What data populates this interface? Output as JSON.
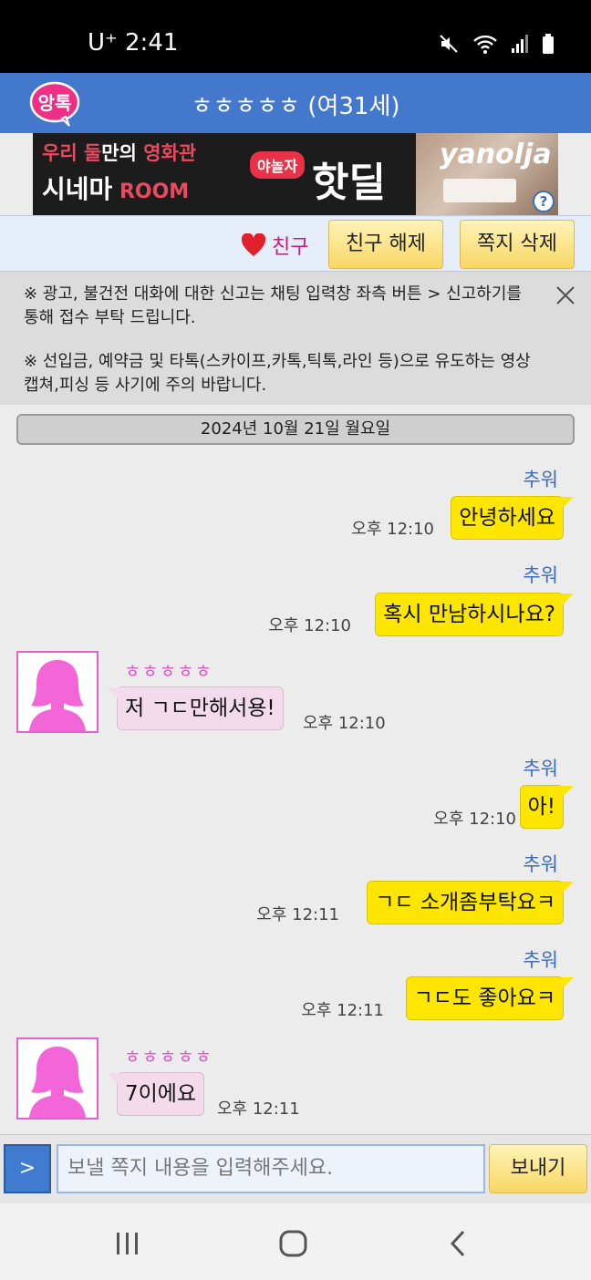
{
  "status_bar": {
    "carrier_time": "U⁺ 2:41",
    "icons": [
      "mute-icon",
      "wifi-icon",
      "signal-icon",
      "battery-icon"
    ]
  },
  "header": {
    "logo_text": "앙톡",
    "title": "ㅎㅎㅎㅎㅎ (여31세)"
  },
  "ad": {
    "line1_a": "우리 둘",
    "line1_b": "만의 ",
    "line1_c": "영화관",
    "line2_a": "시네마",
    "line2_b": " ROOM",
    "pill": "야놀자",
    "hotdeal": "핫딜",
    "brand": "yanolja",
    "help": "?"
  },
  "action_bar": {
    "friend_label": "친구",
    "unfriend_label": "친구 해제",
    "delete_label": "쪽지 삭제"
  },
  "notice": {
    "text1": "※ 광고, 불건전 대화에 대한 신고는 채팅 입력창 좌측 버튼 > 신고하기를 통해 접수 부탁 드립니다.",
    "text2": "※ 선입금, 예약금 및 타톡(스카이프,카톡,틱톡,라인 등)으로 유도하는 영상캡쳐,피싱 등 사기에 주의 바랍니다."
  },
  "date_label": "2024년 10월 21일 월요일",
  "messages": [
    {
      "dir": "out",
      "name": "추워",
      "text": "안녕하세요",
      "time": "오후 12:10"
    },
    {
      "dir": "out",
      "name": "추워",
      "text": "혹시 만남하시나요?",
      "time": "오후 12:10"
    },
    {
      "dir": "in",
      "name": "ㅎㅎㅎㅎㅎ",
      "text": "저 ㄱㄷ만해서용!",
      "time": "오후 12:10"
    },
    {
      "dir": "out",
      "name": "추워",
      "text": "아!",
      "time": "오후 12:10"
    },
    {
      "dir": "out",
      "name": "추워",
      "text": "ㄱㄷ 소개좀부탁요ㅋ",
      "time": "오후 12:11"
    },
    {
      "dir": "out",
      "name": "추워",
      "text": "ㄱㄷ도 좋아요ㅋ",
      "time": "오후 12:11"
    },
    {
      "dir": "in",
      "name": "ㅎㅎㅎㅎㅎ",
      "text": "7이에요",
      "time": "오후 12:11"
    }
  ],
  "input_bar": {
    "toggle_label": ">",
    "placeholder": "보낼 쪽지 내용을 입력해주세요.",
    "send_label": "보내기"
  },
  "nav_bar": {
    "icons": [
      "recent-apps-icon",
      "home-icon",
      "back-icon"
    ]
  },
  "colors": {
    "header_blue": "#4478cd",
    "out_bubble": "#ffe600",
    "in_bubble": "#f3dbec",
    "sender_blue": "#3c6cc4",
    "friend_pink": "#c71b78",
    "avatar_pink": "#f266d8"
  }
}
